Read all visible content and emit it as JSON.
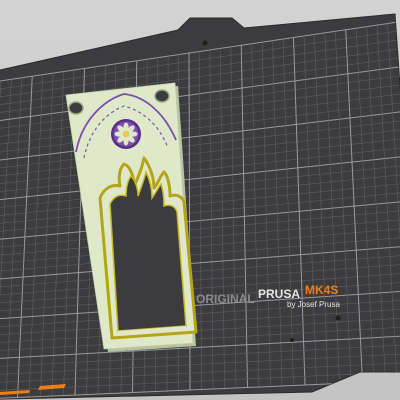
{
  "bed": {
    "brand_prefix": "ORIGINAL",
    "brand_name": "PRUSA",
    "model": "MK4S",
    "byline": "by Josef Prusa"
  },
  "colors": {
    "background": "#c9c9c9",
    "bed_plate": "#3c3c3e",
    "grid_fine": "#5e5e60",
    "grid_major": "#9a9a9c",
    "model_fill": "#dfe8c8",
    "model_outline": "#b4a416",
    "rosette_purple": "#7b4fb0",
    "accent_orange": "#ef7d1a"
  },
  "model": {
    "object": "gothic-window-frame",
    "selected": true
  }
}
